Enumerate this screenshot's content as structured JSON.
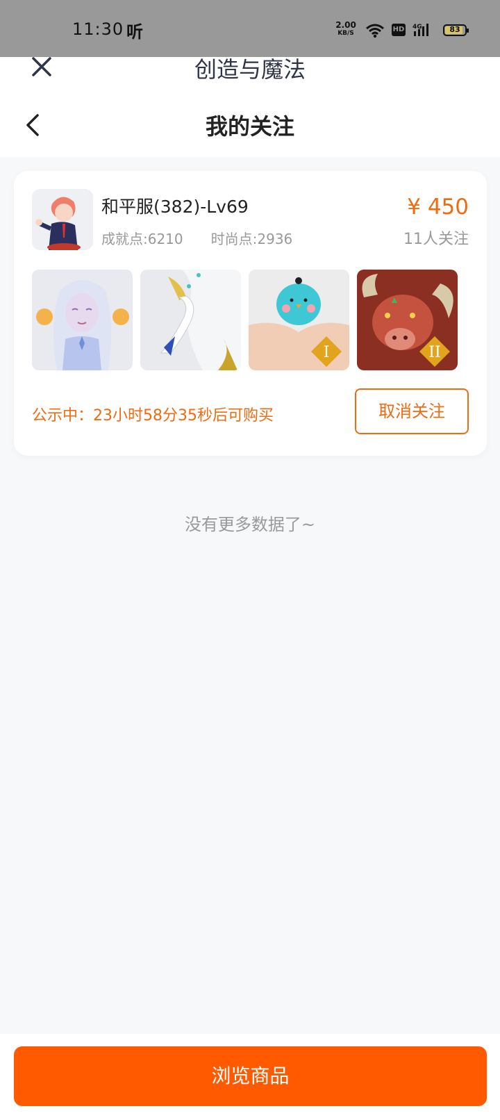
{
  "status_bar": {
    "time": "11:30",
    "extra": "听",
    "net_speed": "2.00",
    "net_unit": "KB/S",
    "hd": "HD",
    "signal_label": "4G",
    "battery": "83"
  },
  "header": {
    "app_title": "创造与魔法",
    "page_title": "我的关注",
    "close_icon": "close-icon",
    "back_icon": "chevron-left-icon"
  },
  "listing": {
    "server": "和平服(382)-Lv69",
    "achievement": "成就点:6210",
    "fashion": "时尚点:2936",
    "price": "¥ 450",
    "followers": "11人关注",
    "notice": "公示中：23小时58分35秒后可购买",
    "unfollow_label": "取消关注",
    "thumbnails": [
      "pet-spirit-thumbnail",
      "swan-mount-thumbnail",
      "bird-pet-thumbnail",
      "demon-mount-thumbnail"
    ],
    "thumb_badges": [
      "I",
      "II"
    ]
  },
  "footer": {
    "no_more": "没有更多数据了~",
    "browse_label": "浏览商品"
  },
  "colors": {
    "accent": "#ff5a00",
    "price_text": "#f06a10",
    "status_bar": "#999999",
    "page_bg": "#f7f8fa"
  }
}
